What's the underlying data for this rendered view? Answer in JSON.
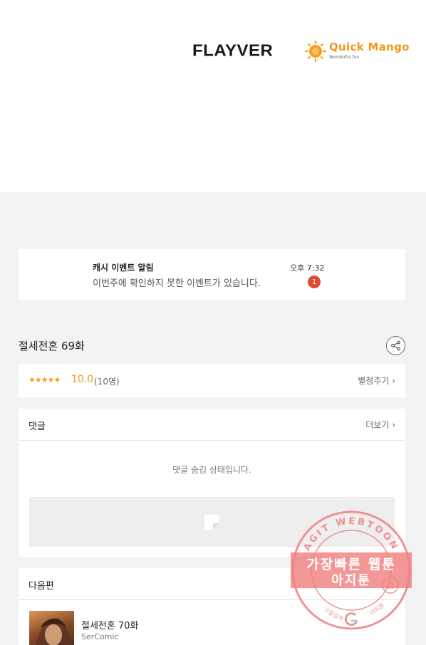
{
  "logos": {
    "flayver": "FLAYVER",
    "quick_mango": {
      "title": "Quick Mango",
      "subtitle": "Wonderful fun"
    }
  },
  "notification": {
    "title": "캐시 이벤트 알림",
    "body": "이번주에 확인하지 못한 이벤트가 있습니다.",
    "time": "오후 7:32",
    "badge": "1"
  },
  "episode": {
    "title": "절세전혼 69화"
  },
  "rating": {
    "stars": "★★★★★",
    "score": "10.0",
    "count": "(10명)",
    "rate_label": "별점주기 ›"
  },
  "comments": {
    "title": "댓글",
    "more_label": "더보기 ›",
    "hidden_message": "댓글 숨김 상태입니다."
  },
  "next": {
    "title": "다음편",
    "item": {
      "title": "절세전혼 70화",
      "subtitle": "SerComic"
    }
  },
  "watermark": {
    "ring_text": "AGIT WEBTOON",
    "line1": "가장빠른 웹툰",
    "line2": "아지툰",
    "bottom_left": "구글검색",
    "bottom_right": "아지툰"
  },
  "colors": {
    "accent_orange": "#f39a1b",
    "badge_red": "#e04a2f",
    "watermark_pink": "#f08080"
  }
}
